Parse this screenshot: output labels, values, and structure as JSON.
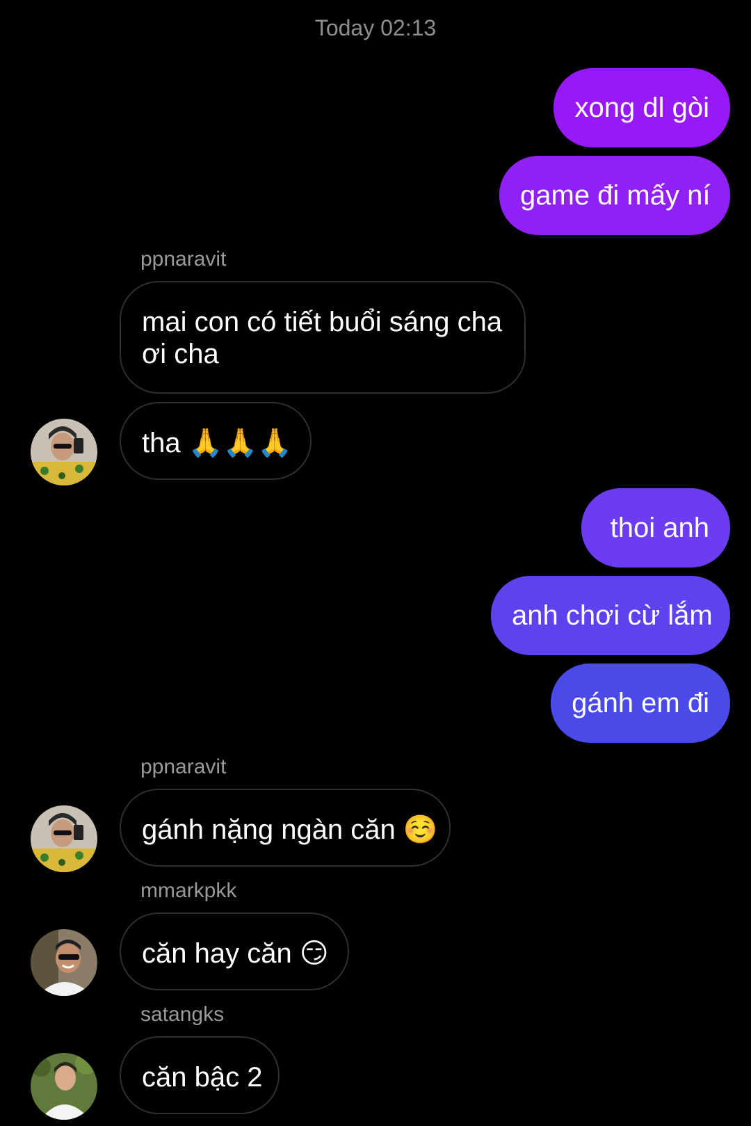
{
  "timestamp": "Today 02:13",
  "messages": [
    {
      "text": "xong dl gòi"
    },
    {
      "text": "game đi mấy ní"
    },
    {
      "sender": "ppnaravit",
      "text": "mai con có tiết buổi sáng cha ơi cha"
    },
    {
      "text": "tha 🙏🙏🙏"
    },
    {
      "text": "thoi anh"
    },
    {
      "text": "anh chơi cừ lắm"
    },
    {
      "text": "gánh em đi"
    },
    {
      "sender": "ppnaravit",
      "text": "gánh nặng ngàn căn ☺️"
    },
    {
      "sender": "mmarkpkk",
      "text": "căn hay căn 😏"
    },
    {
      "sender": "satangks",
      "text": "căn bậc 2"
    }
  ],
  "colors": {
    "outgoing_top": "#9b1cf7",
    "outgoing_mid": "#6a3df0",
    "outgoing_bottom": "#4b4ae8",
    "incoming_border": "#2f2f2f",
    "sender_text": "#9a9a9a",
    "timestamp_text": "#8e8e8e"
  }
}
